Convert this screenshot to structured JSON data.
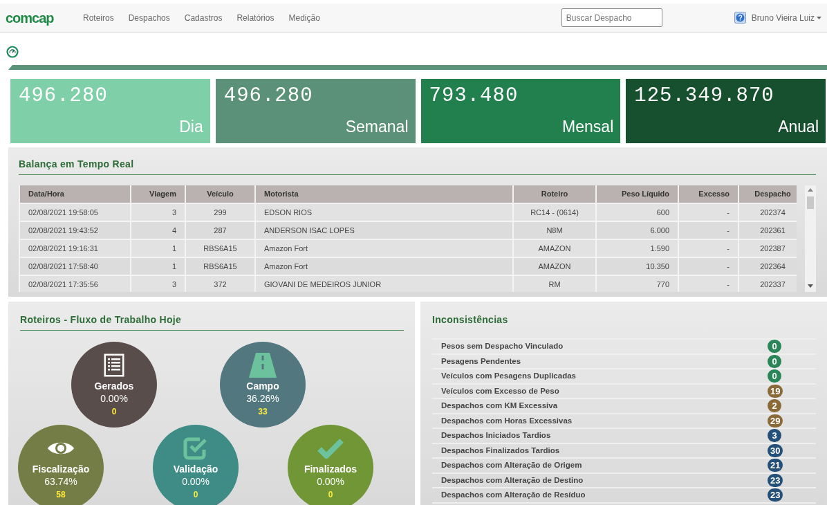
{
  "nav": {
    "brand": "comcap",
    "items": [
      "Roteiros",
      "Despachos",
      "Cadastros",
      "Relatórios",
      "Medição"
    ],
    "search": {
      "placeholder": "Buscar Despacho"
    },
    "user": "Bruno Vieira Luiz"
  },
  "stats": [
    {
      "value": "496.280",
      "label": "Dia",
      "color": "#7fcfa8"
    },
    {
      "value": "496.280",
      "label": "Semanal",
      "color": "#5a9178"
    },
    {
      "value": "793.480",
      "label": "Mensal",
      "color": "#22804f"
    },
    {
      "value": "125.349.870",
      "label": "Anual",
      "color": "#16502e"
    }
  ],
  "balanca": {
    "title": "Balança em Tempo Real",
    "columns": [
      "Data/Hora",
      "Viagem",
      "Veículo",
      "Motorista",
      "Roteiro",
      "Peso Líquido",
      "Excesso",
      "Despacho"
    ],
    "rows": [
      [
        "02/08/2021 19:58:05",
        "3",
        "299",
        "EDSON RIOS",
        "RC14 - (0614)",
        "600",
        "-",
        "202374"
      ],
      [
        "02/08/2021 19:43:52",
        "4",
        "287",
        "ANDERSON ISAC LOPES",
        "N8M",
        "6.000",
        "-",
        "202361"
      ],
      [
        "02/08/2021 19:16:31",
        "1",
        "RBS6A15",
        "Amazon Fort",
        "AMAZON",
        "1.590",
        "-",
        "202387"
      ],
      [
        "02/08/2021 17:58:40",
        "1",
        "RBS6A15",
        "Amazon Fort",
        "AMAZON",
        "10.350",
        "-",
        "202364"
      ],
      [
        "02/08/2021 17:35:56",
        "3",
        "372",
        "GIOVANI DE MEDEIROS JUNIOR",
        "RM",
        "770",
        "-",
        "202337"
      ]
    ]
  },
  "workflow": {
    "title": "Roteiros - Fluxo de Trabalho Hoje",
    "stages": [
      {
        "kind": "list",
        "label": "Gerados",
        "percent": "0.00%",
        "count": "0",
        "color": "#594d4b"
      },
      {
        "kind": "road",
        "label": "Campo",
        "percent": "36.26%",
        "count": "33",
        "color": "#52777e"
      },
      {
        "kind": "eye",
        "label": "Fiscalização",
        "percent": "63.74%",
        "count": "58",
        "color": "#737d45"
      },
      {
        "kind": "checkbox",
        "label": "Validação",
        "percent": "0.00%",
        "count": "0",
        "color": "#3f8c86"
      },
      {
        "kind": "check",
        "label": "Finalizados",
        "percent": "0.00%",
        "count": "0",
        "color": "#719636"
      }
    ]
  },
  "inconsistencias": {
    "title": "Inconsistências",
    "items": [
      {
        "label": "Pesos sem Despacho Vinculado",
        "count": "0",
        "color": "#2a8558"
      },
      {
        "label": "Pesagens Pendentes",
        "count": "0",
        "color": "#2a8558"
      },
      {
        "label": "Veículos com Pesagens Duplicadas",
        "count": "0",
        "color": "#2a8558"
      },
      {
        "label": "Veículos com Excesso de Peso",
        "count": "19",
        "color": "#8a6a38"
      },
      {
        "label": "Despachos com KM Excessiva",
        "count": "2",
        "color": "#8a6a38"
      },
      {
        "label": "Despachos com Horas Excessivas",
        "count": "29",
        "color": "#8a6a38"
      },
      {
        "label": "Despachos Iniciados Tardios",
        "count": "3",
        "color": "#244f78"
      },
      {
        "label": "Despachos Finalizados Tardios",
        "count": "30",
        "color": "#244f78"
      },
      {
        "label": "Despachos com Alteração de Origem",
        "count": "21",
        "color": "#244f78"
      },
      {
        "label": "Despachos com Alteração de Destino",
        "count": "23",
        "color": "#244f78"
      },
      {
        "label": "Despachos com Alteração de Resíduo",
        "count": "23",
        "color": "#244f78"
      }
    ]
  }
}
